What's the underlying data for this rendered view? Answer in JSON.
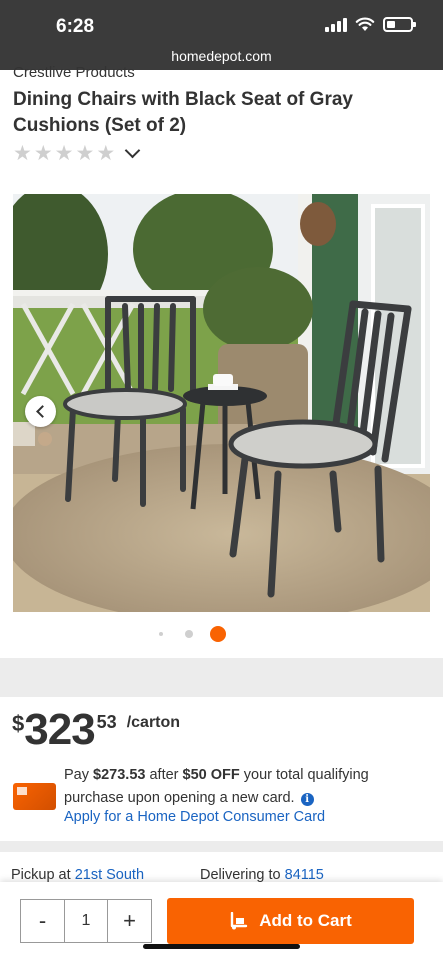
{
  "status": {
    "time": "6:28"
  },
  "browser": {
    "url": "homedepot.com"
  },
  "product": {
    "brand": "Crestlive Products",
    "title": "Dining Chairs with Black Seat of Gray Cushions (Set of 2)",
    "rating_stars": 0
  },
  "gallery": {
    "image_count": 3,
    "active_index": 2,
    "accent": "#f96302"
  },
  "price": {
    "currency": "$",
    "dollars": "323",
    "cents": "53",
    "unit": "/carton"
  },
  "offer": {
    "pay_text": "Pay",
    "discounted_price": "$273.53",
    "after_text": "after",
    "discount": "$50 OFF",
    "rest_text": "your total qualifying purchase upon opening a new card.",
    "apply_link": "Apply for a Home Depot Consumer Card"
  },
  "fulfillment": {
    "pickup_label": "Pickup at",
    "pickup_store": "21st South",
    "delivery_label": "Delivering to",
    "delivery_zip": "84115"
  },
  "cart": {
    "decrement_label": "-",
    "quantity": "1",
    "increment_label": "+",
    "add_label": "Add to Cart"
  },
  "colors": {
    "brand_orange": "#f96302",
    "link_blue": "#1a64c2"
  }
}
